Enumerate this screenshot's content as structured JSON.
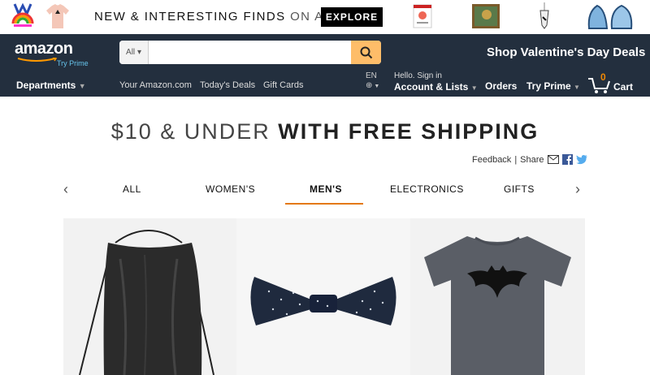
{
  "promo": {
    "text_strong": "NEW & INTERESTING FINDS",
    "text_light": " ON AMAZON",
    "button": "EXPLORE",
    "thumbs_left": [
      "rainbow-figure-icon",
      "shirt-icon"
    ],
    "thumbs_right": [
      "book-icon",
      "painting-icon",
      "pendant-icon",
      "geode-icon"
    ]
  },
  "nav": {
    "logo": "amazon",
    "logo_prime": "Try Prime",
    "search": {
      "category": "All",
      "placeholder": ""
    },
    "right_promo": "Shop Valentine's Day Deals",
    "departments": "Departments",
    "links": [
      "Your Amazon.com",
      "Today's Deals",
      "Gift Cards"
    ],
    "lang": "EN",
    "account_small": "Hello. Sign in",
    "account_big": "Account & Lists",
    "orders": "Orders",
    "try_prime": "Try Prime",
    "cart_count": "0",
    "cart": "Cart"
  },
  "main": {
    "title_light": "$10 & UNDER ",
    "title_bold": "WITH FREE SHIPPING",
    "feedback": "Feedback",
    "share": "Share",
    "tabs": [
      "ALL",
      "WOMEN'S",
      "MEN'S",
      "ELECTRONICS",
      "GIFTS"
    ],
    "active_tab": "MEN'S"
  },
  "products": [
    "drawstring-bag",
    "bow-tie",
    "batman-tshirt"
  ],
  "colors": {
    "nav": "#232f3e",
    "accent": "#febd69",
    "tab_underline": "#e47911",
    "prime_link": "#67c4ec"
  }
}
